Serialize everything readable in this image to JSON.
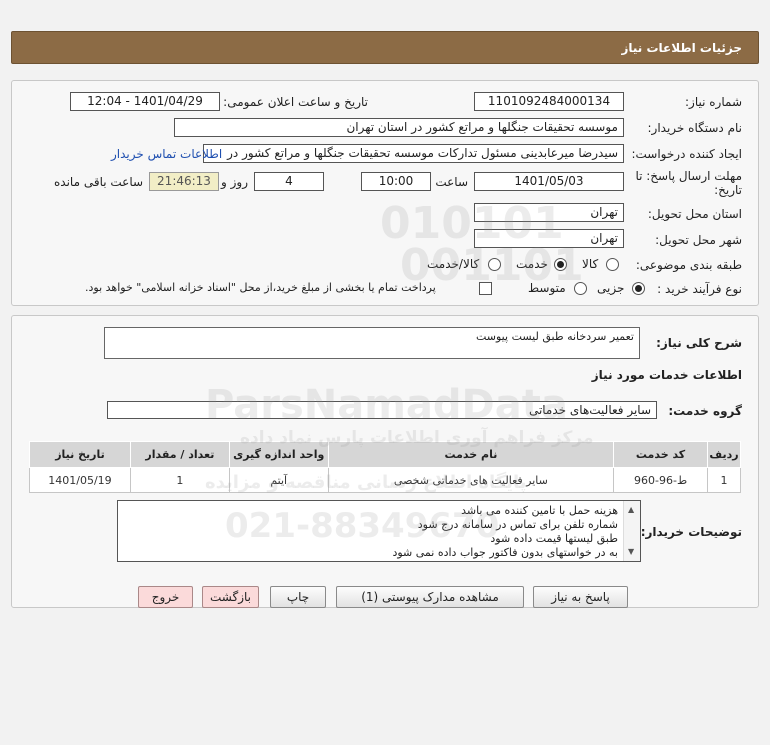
{
  "header": {
    "title": "جزئیات اطلاعات نیاز"
  },
  "details": {
    "need_number_label": "شماره نیاز:",
    "need_number": "1101092484000134",
    "announce_label": "تاریخ و ساعت اعلان عمومی:",
    "announce_value": "1401/04/29 - 12:04",
    "buyer_org_label": "نام دستگاه خریدار:",
    "buyer_org": "موسسه تحقیقات جنگلها و مراتع کشور در استان تهران",
    "requester_label": "ایجاد کننده درخواست:",
    "requester": "سیدرضا میرعابدینی مسئول تدارکات موسسه تحقیقات جنگلها و مراتع کشور در",
    "contact_link": "اطلاعات تماس خریدار",
    "deadline_label_1": "مهلت ارسال پاسخ: تا",
    "deadline_label_2": "تاریخ:",
    "deadline_date": "1401/05/03",
    "time_label": "ساعت",
    "deadline_time": "10:00",
    "days_value": "4",
    "days_label": "روز و",
    "remaining_time": "21:46:13",
    "remaining_label": "ساعت باقی مانده",
    "province_label": "استان محل تحویل:",
    "province": "تهران",
    "city_label": "شهر محل تحویل:",
    "city": "تهران",
    "category_label": "طبقه بندی موضوعی:",
    "category_options": [
      "کالا",
      "خدمت",
      "کالا/خدمت"
    ],
    "category_selected": "خدمت",
    "process_label": "نوع فرآیند خرید :",
    "process_options": [
      "جزیی",
      "متوسط"
    ],
    "process_selected": "جزیی",
    "treasury_text": "پرداخت تمام یا بخشی از مبلغ خرید،از محل \"اسناد خزانه اسلامی\" خواهد بود."
  },
  "description": {
    "label": "شرح کلی نیاز:",
    "value": "تعمیر سردخانه طبق لیست پیوست"
  },
  "services": {
    "section_title": "اطلاعات خدمات مورد نیاز",
    "group_label": "گروه خدمت:",
    "group_value": "سایر فعالیت‌های خدماتی",
    "columns": [
      "ردیف",
      "کد خدمت",
      "نام خدمت",
      "واحد اندازه گیری",
      "تعداد / مقدار",
      "تاریخ نیاز"
    ],
    "rows": [
      [
        "1",
        "ط-96-960",
        "سایر فعالیت های خدماتی شخصی",
        "آیتم",
        "1",
        "1401/05/19"
      ]
    ]
  },
  "buyer_notes": {
    "label": "توضیحات خریدار:",
    "lines": [
      "هزینه حمل با تامین کننده می باشد",
      "شماره تلفن برای تماس در سامانه درج شود",
      "طبق لیستها قیمت داده شود",
      "به در خواستهای بدون فاکتور جواب داده نمی شود"
    ]
  },
  "buttons": {
    "reply": "پاسخ به نیاز",
    "attachments": "مشاهده مدارک پیوستی (1)",
    "print": "چاپ",
    "back": "بازگشت",
    "exit": "خروج"
  },
  "watermark": {
    "brand": "ParsNamadData",
    "line1": "مرکز فراهم آوری اطلاعات پارس نماد داده",
    "line2": "پایگاه اطلاع رسانی مناقصه و مزایده",
    "phone": "021-88349670"
  },
  "colors": {
    "header": "#8c6b45",
    "link": "#1f4fb0",
    "remaining_bg": "#f2eec6"
  }
}
